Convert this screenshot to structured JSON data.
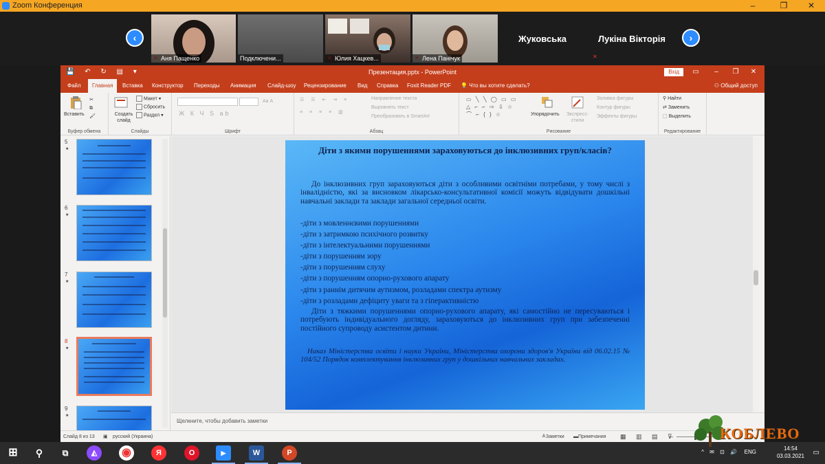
{
  "zoom": {
    "title": "Zoom Конференция",
    "window_controls": [
      "–",
      "❐",
      "✕"
    ],
    "participants": [
      {
        "name": "Аня Пащенко",
        "muted": true
      },
      {
        "name": "Подключени...",
        "muted": false
      },
      {
        "name": "Юлия Хацкев...",
        "muted": true
      },
      {
        "name": "Лена Панічук",
        "muted": true
      },
      {
        "name": "Жуковська",
        "muted": false
      },
      {
        "name": "Лукіна Вікторія",
        "muted": true
      }
    ],
    "prev_arrow": "‹",
    "next_arrow": "›"
  },
  "ppt": {
    "quick_access": "💾 ↶ ↻ ▤ ▾",
    "title": "Презентация.pptx - PowerPoint",
    "sign_in": "Вхід",
    "window_controls": [
      "▭",
      "–",
      "❐",
      "✕"
    ],
    "tabs": [
      "Файл",
      "Главная",
      "Вставка",
      "Конструктор",
      "Переходы",
      "Анимация",
      "Слайд-шоу",
      "Рецензирование",
      "Вид",
      "Справка",
      "Foxit Reader PDF",
      "Что вы хотите сделать?"
    ],
    "active_tab": "Главная",
    "share": "Общий доступ",
    "ribbon": {
      "clipboard": {
        "paste": "Вставить",
        "label": "Буфер обмена"
      },
      "slides": {
        "new_slide": "Создать слайд",
        "layout": "Макет",
        "reset": "Сбросить",
        "section": "Раздел",
        "label": "Слайды"
      },
      "font": {
        "label": "Шрифт",
        "format_buttons": "Ж К Ч S аb",
        "size_buttons": "Aa А"
      },
      "paragraph": {
        "text_direction": "Направление текста",
        "align_text": "Выровнять текст",
        "smartart": "Преобразовать в SmartArt",
        "label": "Абзац"
      },
      "drawing": {
        "arrange": "Упорядочить",
        "quick_styles": "Экспресс-стили",
        "fill": "Заливка фигуры",
        "outline": "Контур фигуры",
        "effects": "Эффекты фигуры",
        "label": "Рисование",
        "shapes": "▭ ╲ ╲ ◯ ▭ ▭ △ ⌐ ⌐ ⇨ ⇩ ☆ ⌒ ⌐ { } ☆"
      },
      "editing": {
        "find": "Найти",
        "replace": "Заменить",
        "select": "Выделить",
        "label": "Редактирование"
      }
    },
    "thumbnails": [
      {
        "num": "5",
        "selected": false
      },
      {
        "num": "6",
        "selected": false
      },
      {
        "num": "7",
        "selected": false
      },
      {
        "num": "8",
        "selected": true
      },
      {
        "num": "9",
        "selected": false
      }
    ],
    "thumb_star": "★",
    "slide": {
      "title": "Діти з якими порушеннями зараховуються до інклюзивних груп/класів?",
      "intro": "До інклюзивних груп зараховуються діти з особливими освітніми потребами, у тому числі з інвалідністю, які за висновком лікарсько-консультативної комісії можуть відвідувати дошкільні навчальні заклади та заклади загальної середньої освіти.",
      "list": [
        "-діти з мовленнєвими порушеннями",
        "-діти з затримкою психічного розвитку",
        "-діти з інтелектуальними порушеннями",
        "-діти з порушенням зору",
        "-діти з порушенням слуху",
        "-діти з порушенням опорно-рухового апарату",
        "-діти з раннім дитячим аутизмом, розладами спектра аутизму",
        "-діти з розладами  дефіциту уваги та з гіперактивністю"
      ],
      "paragraph2": "Діти з тяжкими порушеннями опорно-рухового апарату, які самостійно не пересуваються і потребують індивідуального догляду, зараховуються до інклюзивних груп при забезпеченні постійного супроводу асистентом дитини.",
      "reference": "Наказ Міністерства освіти і науки України, Міністерства охорони здоров'я України від 06.02.15 № 104/52 Порядок комплектування інклюзивних груп у дошкільних навчальних закладах."
    },
    "notes_placeholder": "Щелкните, чтобы добавить заметки",
    "status": {
      "slide_of": "Слайд 8 из 13",
      "language": "русский (Украина)",
      "notes": "Заметки",
      "comments": "Примечания",
      "view_icons": "▦ ▥ ▤ ⊽",
      "zoom_minus": "–",
      "zoom_plus": "+"
    }
  },
  "taskbar": {
    "start": "⊞",
    "search": "⚲",
    "taskview": "⧉",
    "apps": [
      {
        "name": "Алиса",
        "glyph": "◭",
        "color": "#8c4bff"
      },
      {
        "name": "Chrome",
        "glyph": "◉",
        "color": "#34a853"
      },
      {
        "name": "Yandex",
        "glyph": "Я",
        "color": "#ff3333"
      },
      {
        "name": "Opera",
        "glyph": "O",
        "color": "#e0142a"
      },
      {
        "name": "Zoom",
        "glyph": "▶",
        "color": "#2d8cff"
      },
      {
        "name": "Word",
        "glyph": "W",
        "color": "#2b579a"
      },
      {
        "name": "PowerPoint",
        "glyph": "P",
        "color": "#d24726"
      }
    ],
    "lang": "ENG",
    "time": "14:54",
    "date": "03.03.2021",
    "tray_icons": "^ ✉ ⊡ 🔊",
    "notify": "▭"
  },
  "watermark": {
    "text": "КОБЛЕВО"
  }
}
